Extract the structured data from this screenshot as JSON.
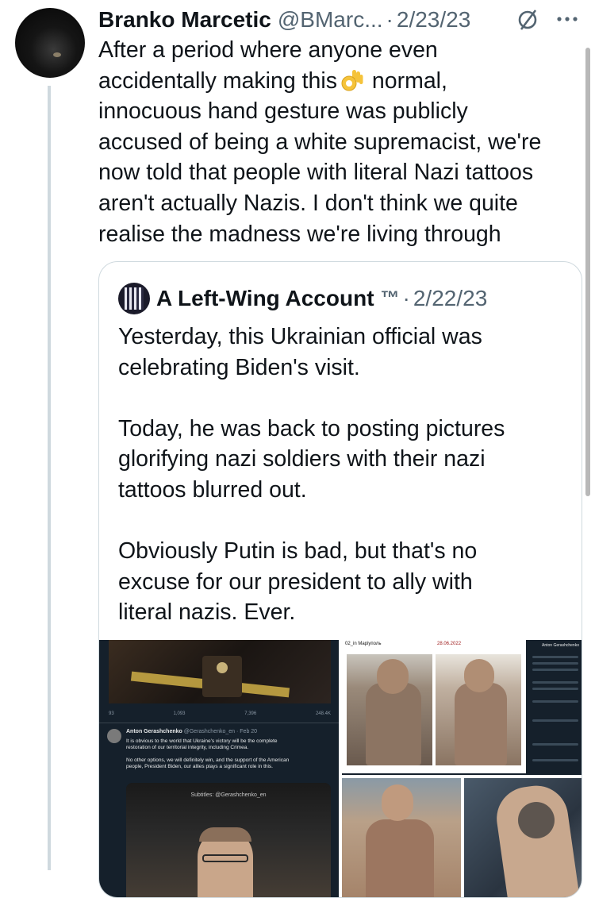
{
  "tweet": {
    "author_name": "Branko Marcetic",
    "author_handle": "@BMarc...",
    "separator": "·",
    "date": "2/23/23",
    "text_before_emoji": "After a period where anyone even\naccidentally making this",
    "text_after_emoji": " normal,\ninnocuous hand gesture was publicly\naccused of being a white supremacist, we're\nnow told that people with literal Nazi tattoos\naren't actually Nazis. I don't think we quite\nrealise the madness we're living through",
    "emoji_name": "ok-hand-emoji"
  },
  "icons": {
    "hide": "hide-reply-icon",
    "more": "more-options-icon"
  },
  "quote": {
    "author_name": "A Left-Wing Account",
    "badge": "™",
    "separator": "·",
    "date": "2/22/23",
    "text": "Yesterday, this Ukrainian official was\ncelebrating Biden's visit.\n\nToday, he was back to posting pictures\nglorifying nazi soldiers with their nazi\ntattoos blurred out.\n\nObviously Putin is bad, but that's no\nexcuse for our president to ally with\nliteral nazis. Ever."
  },
  "media": {
    "left": {
      "stats": [
        "93",
        "1,093",
        "7,396",
        "248.4K"
      ],
      "embedded_author": "Anton Gerashchenko",
      "embedded_handle": "@Gerashchenko_en · Feb 20",
      "embedded_text": "It is obvious to the world that Ukraine's victory will be the complete\nrestoration of our territorial integrity, including Crimea.\n\nNo other options, we will definitely win, and the support of the American\npeople, President Biden, our allies plays a significant role in this.",
      "subtitle": "Subtitles: @Gerashchenko_en"
    },
    "top_right": {
      "label_left": "02_in Маріуполь",
      "label_right": "28.06.2022",
      "side_name": "Anton Gerashchenko"
    }
  }
}
